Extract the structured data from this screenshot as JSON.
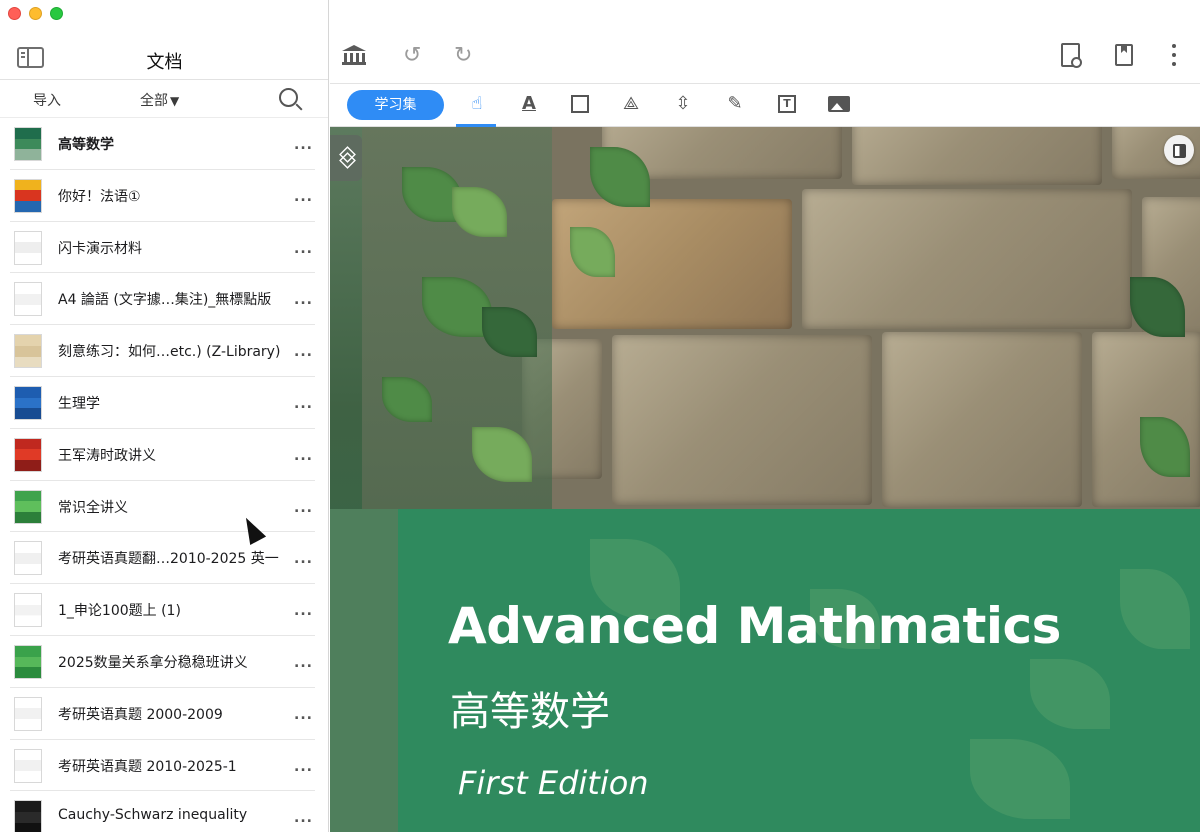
{
  "sidebar": {
    "title": "文档",
    "import_label": "导入",
    "filter_label": "全部",
    "filter_caret": "▼",
    "documents": [
      {
        "title": "高等数学",
        "bold": true,
        "thumb": [
          "#1f6d4c",
          "#3d8a5a",
          "#8fb39a"
        ]
      },
      {
        "title": "你好！法语①",
        "bold": false,
        "thumb": [
          "#f0b21d",
          "#d9351f",
          "#2467b0"
        ]
      },
      {
        "title": "闪卡演示材料",
        "bold": false,
        "thumb": [
          "#ffffff",
          "#eeeeee",
          "#ffffff"
        ]
      },
      {
        "title": "A4 論語 (文字據…集注)_無標點版",
        "bold": false,
        "thumb": [
          "#ffffff",
          "#f1f1f1",
          "#ffffff"
        ]
      },
      {
        "title": "刻意练习：如何…etc.) (Z-Library)",
        "bold": false,
        "thumb": [
          "#e4d3ad",
          "#d8c49a",
          "#e8dcc0"
        ]
      },
      {
        "title": "生理学",
        "bold": false,
        "thumb": [
          "#1e5db0",
          "#2b72c8",
          "#184c92"
        ]
      },
      {
        "title": "王军涛时政讲义",
        "bold": false,
        "thumb": [
          "#c0281f",
          "#e03a26",
          "#8f1d18"
        ]
      },
      {
        "title": "常识全讲义",
        "bold": false,
        "thumb": [
          "#3fa34d",
          "#5fbf5c",
          "#2c7f3a"
        ]
      },
      {
        "title": "考研英语真题翻…2010-2025 英一",
        "bold": false,
        "thumb": [
          "#ffffff",
          "#f0f0f0",
          "#ffffff"
        ]
      },
      {
        "title": "1_申论100题上 (1)",
        "bold": false,
        "thumb": [
          "#ffffff",
          "#f2f2f2",
          "#ffffff"
        ]
      },
      {
        "title": "2025数量关系拿分稳稳班讲义",
        "bold": false,
        "thumb": [
          "#3aa24b",
          "#56b85a",
          "#2b8b3d"
        ]
      },
      {
        "title": "考研英语真题 2000-2009",
        "bold": false,
        "thumb": [
          "#ffffff",
          "#f1f1f1",
          "#ffffff"
        ]
      },
      {
        "title": "考研英语真题 2010-2025-1",
        "bold": false,
        "thumb": [
          "#ffffff",
          "#f1f1f1",
          "#ffffff"
        ]
      },
      {
        "title": "Cauchy-Schwarz inequality",
        "bold": false,
        "thumb": [
          "#1a1a1a",
          "#2a2a2a",
          "#111111"
        ]
      }
    ],
    "more_glyph": "..."
  },
  "toolbar": {
    "study_set_label": "学习集",
    "undo_glyph": "↺",
    "redo_glyph": "↻",
    "tools": [
      {
        "name": "pointer-tool",
        "glyph": "☝",
        "active": true
      },
      {
        "name": "text-color-tool",
        "glyph": "A",
        "active": false
      },
      {
        "name": "rect-select-tool",
        "glyph": "",
        "active": false
      },
      {
        "name": "lasso-tool",
        "glyph": "⟁",
        "active": false
      },
      {
        "name": "expand-tool",
        "glyph": "⇳",
        "active": false
      },
      {
        "name": "pen-tool",
        "glyph": "✎",
        "active": false
      },
      {
        "name": "textbox-tool",
        "glyph": "T",
        "active": false
      },
      {
        "name": "image-tool",
        "glyph": "",
        "active": false
      }
    ]
  },
  "document": {
    "title_en": "Advanced Mathmatics",
    "title_zh": "高等数学",
    "edition": "First Edition"
  },
  "colors": {
    "accent": "#2f8cf5",
    "cover_green": "#2f8a5e"
  }
}
